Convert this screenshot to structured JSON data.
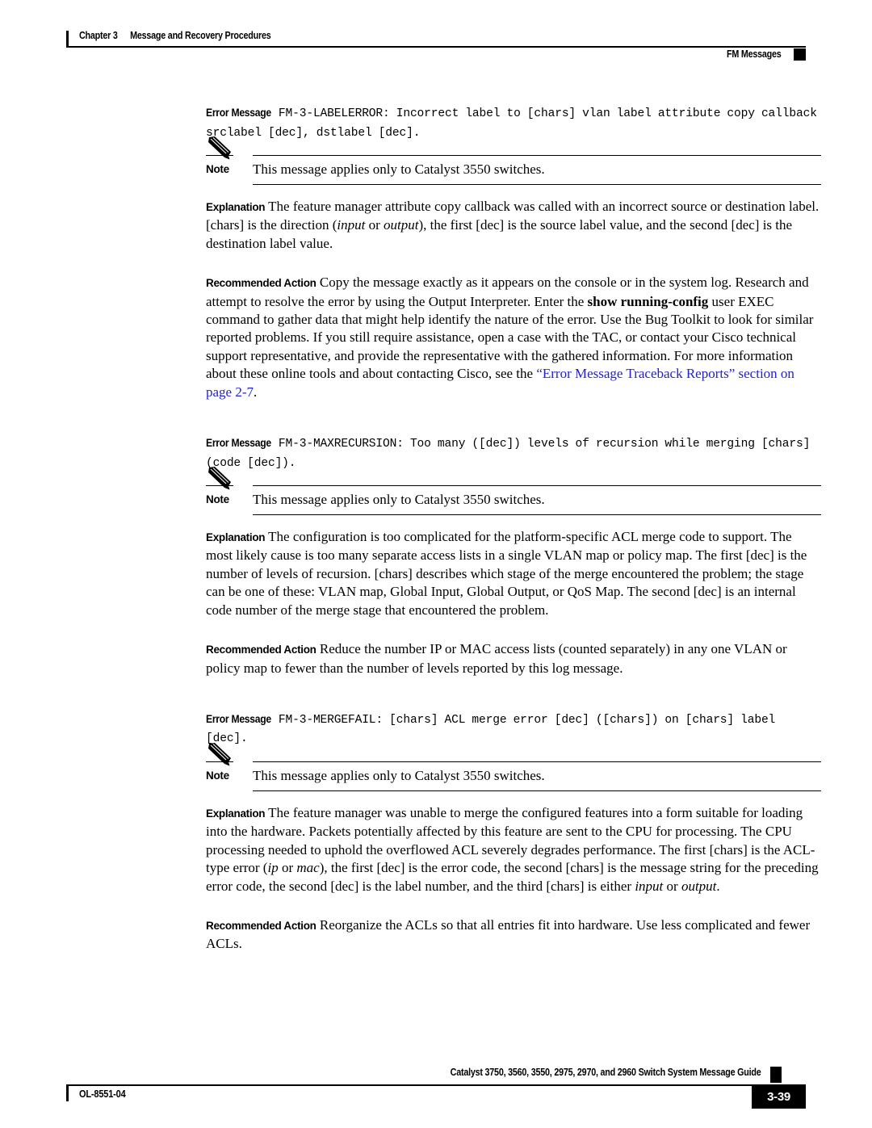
{
  "header": {
    "chapter": "Chapter 3",
    "chapter_title": "Message and Recovery Procedures",
    "section": "FM Messages"
  },
  "footer": {
    "doc_id": "OL-8551-04",
    "guide_title": "Catalyst 3750, 3560, 3550, 2975, 2970, and 2960 Switch System Message Guide",
    "page_number": "3-39"
  },
  "labels": {
    "error_message": "Error Message",
    "note": "Note",
    "explanation": "Explanation",
    "recommended_action": "Recommended Action"
  },
  "messages": [
    {
      "id": "FM-3-LABELERROR",
      "code": "FM-3-LABELERROR: Incorrect label to [chars] vlan label attribute copy callback srclabel [dec], dstlabel [dec].",
      "note": "This message applies only to Catalyst 3550 switches.",
      "explanation_part1": "The feature manager attribute copy callback was called with an incorrect source or destination label. [chars] is the direction (",
      "explanation_em1": "input",
      "explanation_part2": " or ",
      "explanation_em2": "output",
      "explanation_part3": "), the first [dec] is the source label value, and the second [dec] is the destination label value.",
      "action_part1": "Copy the message exactly as it appears on the console or in the system log. Research and attempt to resolve the error by using the Output Interpreter. Enter the ",
      "action_bold1": "show running-config",
      "action_part2": " user EXEC command to gather data that might help identify the nature of the error. Use the Bug Toolkit to look for similar reported problems. If you still require assistance, open a case with the TAC, or contact your Cisco technical support representative, and provide the representative with the gathered information. For more information about these online tools and about contacting Cisco, see the ",
      "action_link": "“Error Message Traceback Reports” section on page 2-7",
      "action_part3": "."
    },
    {
      "id": "FM-3-MAXRECURSION",
      "code": "FM-3-MAXRECURSION: Too many ([dec]) levels of recursion while merging [chars] (code [dec]).",
      "note": "This message applies only to Catalyst 3550 switches.",
      "explanation": "The configuration is too complicated for the platform-specific ACL merge code to support. The most likely cause is too many separate access lists in a single VLAN map or policy map. The first [dec] is the number of levels of recursion. [chars] describes which stage of the merge encountered the problem; the stage can be one of these: VLAN map, Global Input, Global Output, or QoS Map. The second [dec] is an internal code number of the merge stage that encountered the problem.",
      "action": "Reduce the number IP or MAC access lists (counted separately) in any one VLAN or policy map to fewer than the number of levels reported by this log message."
    },
    {
      "id": "FM-3-MERGEFAIL",
      "code": "FM-3-MERGEFAIL: [chars] ACL merge error [dec] ([chars]) on [chars] label [dec].",
      "note": "This message applies only to Catalyst 3550 switches.",
      "explanation_part1": "The feature manager was unable to merge the configured features into a form suitable for loading into the hardware. Packets potentially affected by this feature are sent to the CPU for processing. The CPU processing needed to uphold the overflowed ACL severely degrades performance. The first [chars] is the ACL-type error (",
      "explanation_em1": "ip",
      "explanation_part2": " or ",
      "explanation_em2": "mac",
      "explanation_part3": "), the first [dec] is the error code, the second [chars] is the message string for the preceding error code, the second [dec] is the label number, and the third [chars] is either ",
      "explanation_em3": "input",
      "explanation_part4": " or ",
      "explanation_em4": "output",
      "explanation_part5": ".",
      "action": "Reorganize the ACLs so that all entries fit into hardware. Use less complicated and fewer ACLs."
    }
  ],
  "colors": {
    "link": "#2222cc",
    "text": "#000000",
    "rule": "#000000"
  }
}
